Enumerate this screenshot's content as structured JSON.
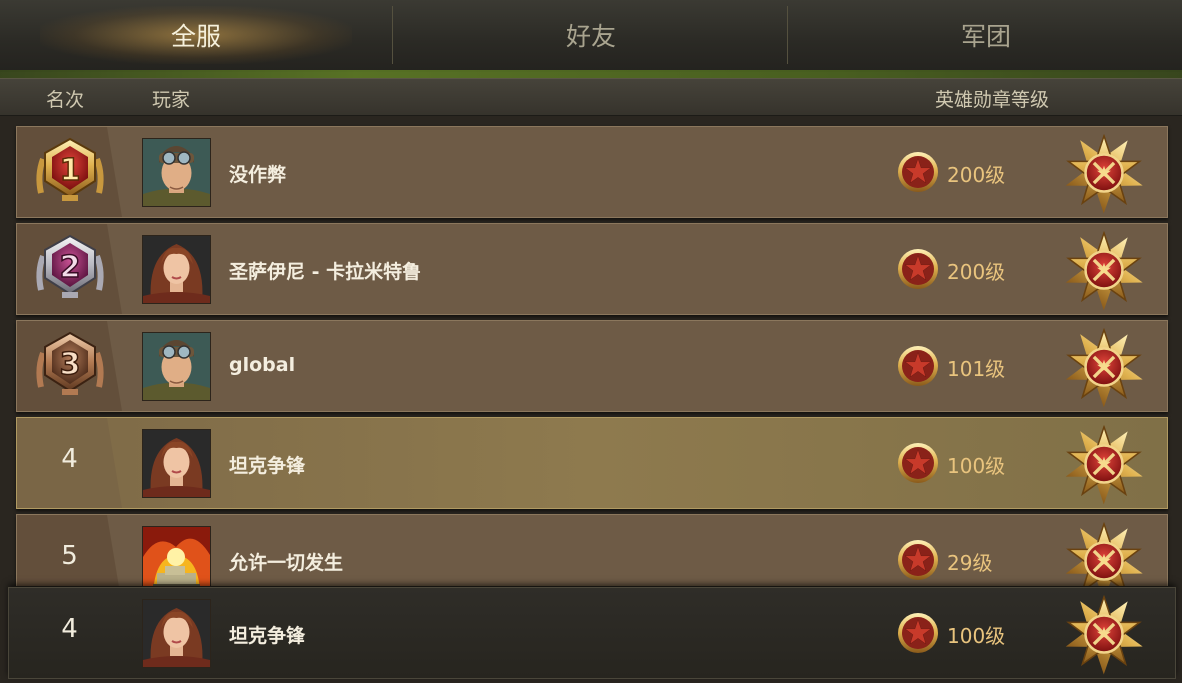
{
  "tabs": [
    {
      "label": "全服",
      "active": true
    },
    {
      "label": "好友",
      "active": false
    },
    {
      "label": "军团",
      "active": false
    }
  ],
  "columns": {
    "rank": "名次",
    "player": "玩家",
    "medal_level": "英雄勋章等级"
  },
  "rows": [
    {
      "rank": "1",
      "medal": "gold-rank-medal",
      "avatar": "pilot-male-avatar",
      "name": "没作弊",
      "level": "200级"
    },
    {
      "rank": "2",
      "medal": "purple-rank-medal",
      "avatar": "female-avatar",
      "name": "圣萨伊尼 - 卡拉米特鲁",
      "level": "200级"
    },
    {
      "rank": "3",
      "medal": "bronze-rank-medal",
      "avatar": "pilot-male-avatar",
      "name": "global",
      "level": "101级"
    },
    {
      "rank": "4",
      "avatar": "female-avatar",
      "name": "坦克争锋",
      "level": "100级",
      "highlight": true
    },
    {
      "rank": "5",
      "avatar": "tank-fire-avatar",
      "name": "允许一切发生",
      "level": "29级"
    }
  ],
  "own": {
    "rank": "4",
    "avatar": "female-avatar",
    "name": "坦克争锋",
    "level": "100级"
  },
  "colors": {
    "gold": "#e8c47a",
    "row": "#6e5b46",
    "highlight": "#8e7a4e",
    "own_row": "#2b2924",
    "medal_red": "#a01818",
    "purple": "#8e2a66",
    "bronze": "#7a4a30"
  }
}
